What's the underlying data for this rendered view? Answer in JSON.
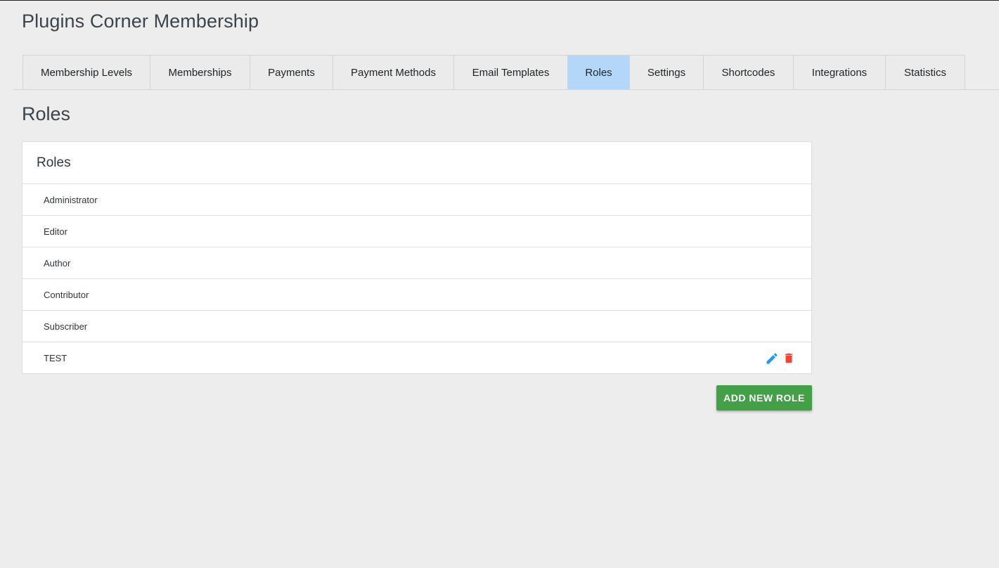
{
  "app": {
    "title": "Plugins Corner Membership"
  },
  "tabs": [
    {
      "label": "Membership Levels"
    },
    {
      "label": "Memberships"
    },
    {
      "label": "Payments"
    },
    {
      "label": "Payment Methods"
    },
    {
      "label": "Email Templates"
    },
    {
      "label": "Roles",
      "active": true
    },
    {
      "label": "Settings"
    },
    {
      "label": "Shortcodes"
    },
    {
      "label": "Integrations"
    },
    {
      "label": "Statistics"
    }
  ],
  "page": {
    "heading": "Roles"
  },
  "roles_card": {
    "title": "Roles",
    "rows": [
      {
        "name": "Administrator"
      },
      {
        "name": "Editor"
      },
      {
        "name": "Author"
      },
      {
        "name": "Contributor"
      },
      {
        "name": "Subscriber"
      },
      {
        "name": "TEST",
        "actions": [
          "pencil-icon",
          "trash-icon"
        ]
      }
    ]
  },
  "add_button": {
    "label": "ADD NEW ROLE"
  },
  "colors": {
    "active_tab": "#b3d7f9",
    "edit_icon": "#2196f3",
    "delete_icon": "#f44336",
    "add_button": "#43a047"
  }
}
